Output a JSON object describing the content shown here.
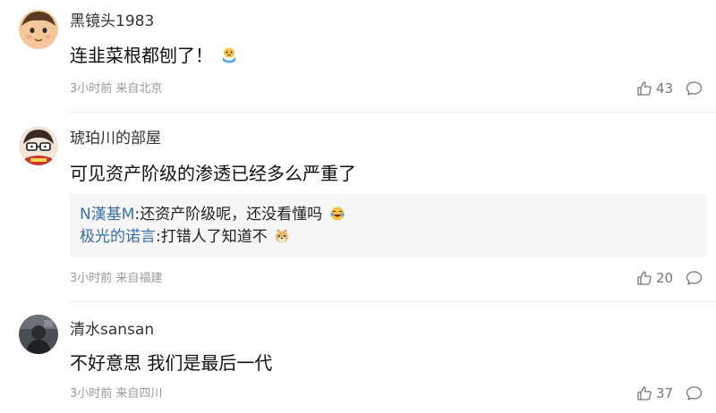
{
  "comments": [
    {
      "username": "黑镜头1983",
      "content": "连韭菜根都刨了！",
      "content_emoji": "cry-face-emoji",
      "time": "3小时前",
      "location": "来自北京",
      "likes": "43",
      "avatar_icon": "cartoon-face-avatar"
    },
    {
      "username": "琥珀川的部屋",
      "content": "可见资产阶级的渗透已经多么严重了",
      "replies": [
        {
          "user": "N漢基M",
          "sep": ":",
          "text": "还资产阶级呢，还没看懂吗",
          "emoji": "laugh-cry-emoji"
        },
        {
          "user": "极光的诺言",
          "sep": ":",
          "text": "打错人了知道不",
          "emoji": "doge-emoji"
        }
      ],
      "time": "3小时前",
      "location": "来自福建",
      "likes": "20",
      "avatar_icon": "glasses-cartoon-avatar"
    },
    {
      "username": "清水sansan",
      "content": "不好意思 我们是最后一代",
      "time": "3小时前",
      "location": "来自四川",
      "likes": "37",
      "avatar_icon": "photo-avatar"
    }
  ],
  "colors": {
    "username_link": "#3a6ea5",
    "meta_gray": "#999999",
    "subreply_bg": "#f6f6f6"
  }
}
